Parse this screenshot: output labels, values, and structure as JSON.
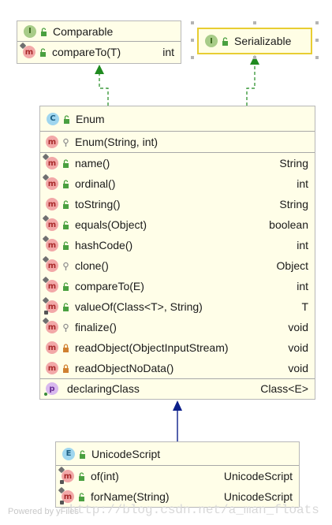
{
  "watermark": "http://blog.csdn.net/a_man_floats",
  "powered_by": "Powered by yFiles",
  "comparable": {
    "kind": "I",
    "name": "Comparable",
    "members": [
      {
        "badge": "m",
        "name": "compareTo(T)",
        "type": "int",
        "vis": "public",
        "mark": "abstract"
      }
    ]
  },
  "serializable": {
    "kind": "I",
    "name": "Serializable"
  },
  "enum": {
    "kind": "C",
    "name": "Enum",
    "constructors": [
      {
        "badge": "m",
        "name": "Enum(String, int)",
        "type": "",
        "vis": "protected",
        "mark": ""
      }
    ],
    "methods": [
      {
        "badge": "m",
        "name": "name()",
        "type": "String",
        "vis": "public",
        "mark": "final"
      },
      {
        "badge": "m",
        "name": "ordinal()",
        "type": "int",
        "vis": "public",
        "mark": "final"
      },
      {
        "badge": "m",
        "name": "toString()",
        "type": "String",
        "vis": "public",
        "mark": ""
      },
      {
        "badge": "m",
        "name": "equals(Object)",
        "type": "boolean",
        "vis": "public",
        "mark": "final"
      },
      {
        "badge": "m",
        "name": "hashCode()",
        "type": "int",
        "vis": "public",
        "mark": "final"
      },
      {
        "badge": "m",
        "name": "clone()",
        "type": "Object",
        "vis": "protected",
        "mark": "final"
      },
      {
        "badge": "m",
        "name": "compareTo(E)",
        "type": "int",
        "vis": "public",
        "mark": "final"
      },
      {
        "badge": "m",
        "name": "valueOf(Class<T>, String)",
        "type": "T",
        "vis": "public",
        "mark": "static"
      },
      {
        "badge": "m",
        "name": "finalize()",
        "type": "void",
        "vis": "protected",
        "mark": "final"
      },
      {
        "badge": "m",
        "name": "readObject(ObjectInputStream)",
        "type": "void",
        "vis": "private",
        "mark": ""
      },
      {
        "badge": "m",
        "name": "readObjectNoData()",
        "type": "void",
        "vis": "private",
        "mark": ""
      }
    ],
    "properties": [
      {
        "badge": "p",
        "name": "declaringClass",
        "type": "Class<E>",
        "vis": "public",
        "mark": "dot"
      }
    ]
  },
  "unicode_script": {
    "kind": "E",
    "name": "UnicodeScript",
    "methods": [
      {
        "badge": "m",
        "name": "of(int)",
        "type": "UnicodeScript",
        "vis": "public",
        "mark": "static"
      },
      {
        "badge": "m",
        "name": "forName(String)",
        "type": "UnicodeScript",
        "vis": "public",
        "mark": "static"
      }
    ]
  },
  "colors": {
    "box_bg": "#fffee8",
    "selected_border": "#e8cd32",
    "implements_arrow": "#1f8a1f",
    "extends_arrow": "#0b1f8a",
    "public_icon": "#4aa040",
    "private_icon": "#d08030",
    "protected_icon": "#909090"
  }
}
